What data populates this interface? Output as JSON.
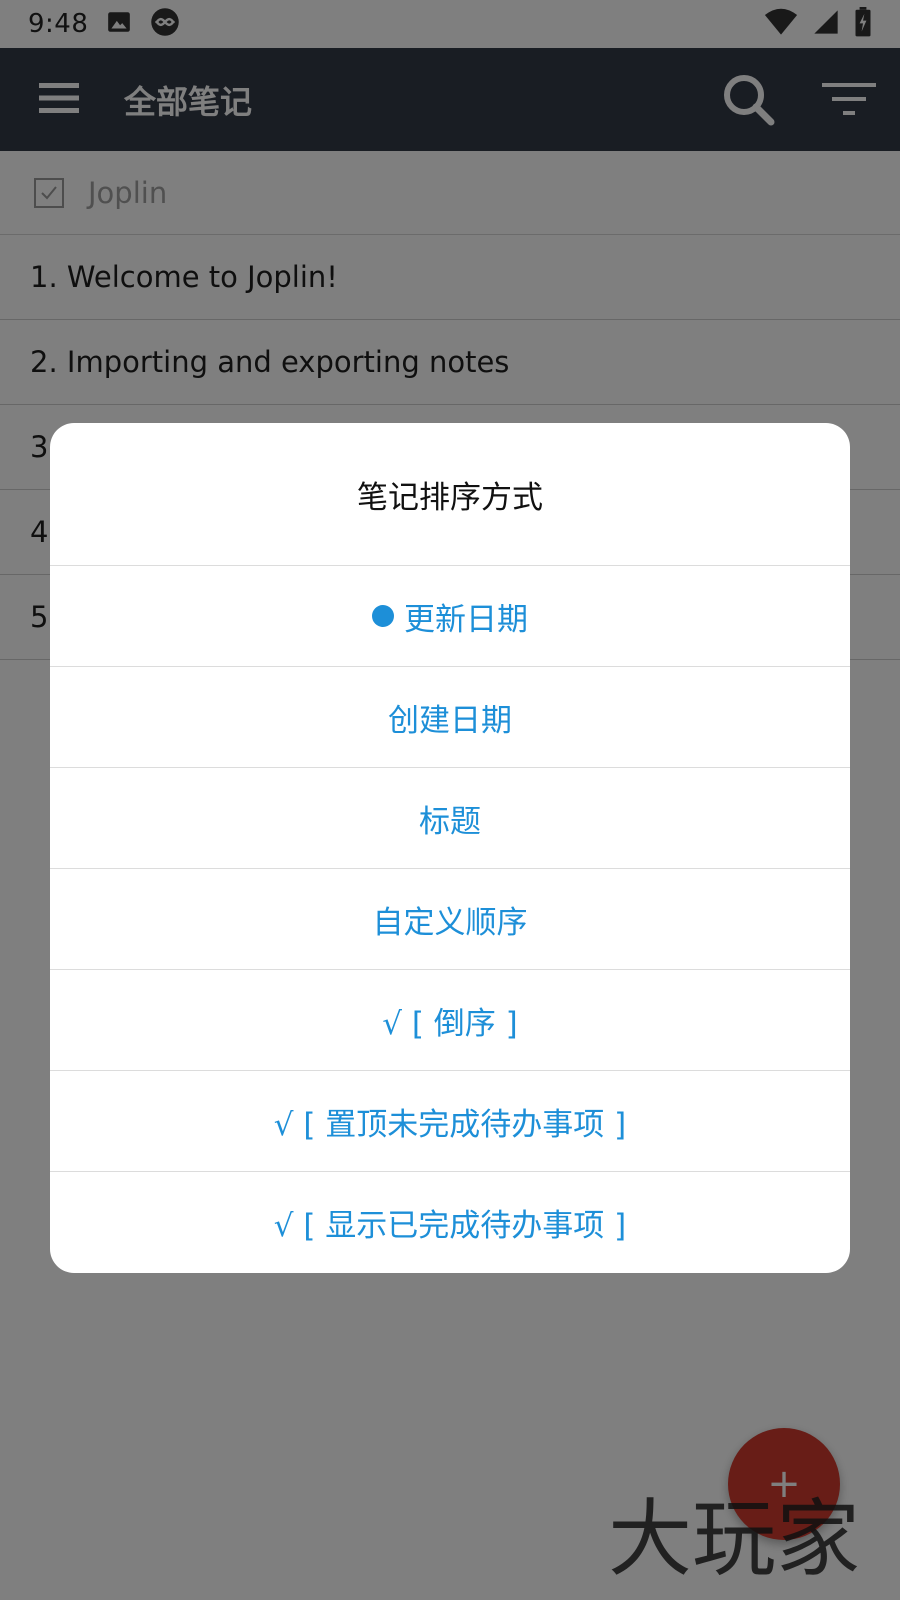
{
  "status_bar": {
    "time": "9:48"
  },
  "header": {
    "title": "全部笔记"
  },
  "notes": {
    "folder_label": "Joplin",
    "items": [
      "1. Welcome to Joplin!",
      "2. Importing and exporting notes",
      "3",
      "4",
      "5"
    ]
  },
  "dialog": {
    "title": "笔记排序方式",
    "options": [
      "更新日期",
      "创建日期",
      "标题",
      "自定义顺序",
      "√ [ 倒序 ]",
      "√ [ 置顶未完成待办事项 ]",
      "√ [ 显示已完成待办事项 ]"
    ],
    "selected_option_index": 0
  },
  "fab": {
    "icon": "plus-icon",
    "symbol": "+"
  },
  "watermark": {
    "text": "大玩家"
  },
  "colors": {
    "header_bg": "#333a47",
    "accent": "#1d8fd8",
    "fab": "#d03a2e"
  }
}
